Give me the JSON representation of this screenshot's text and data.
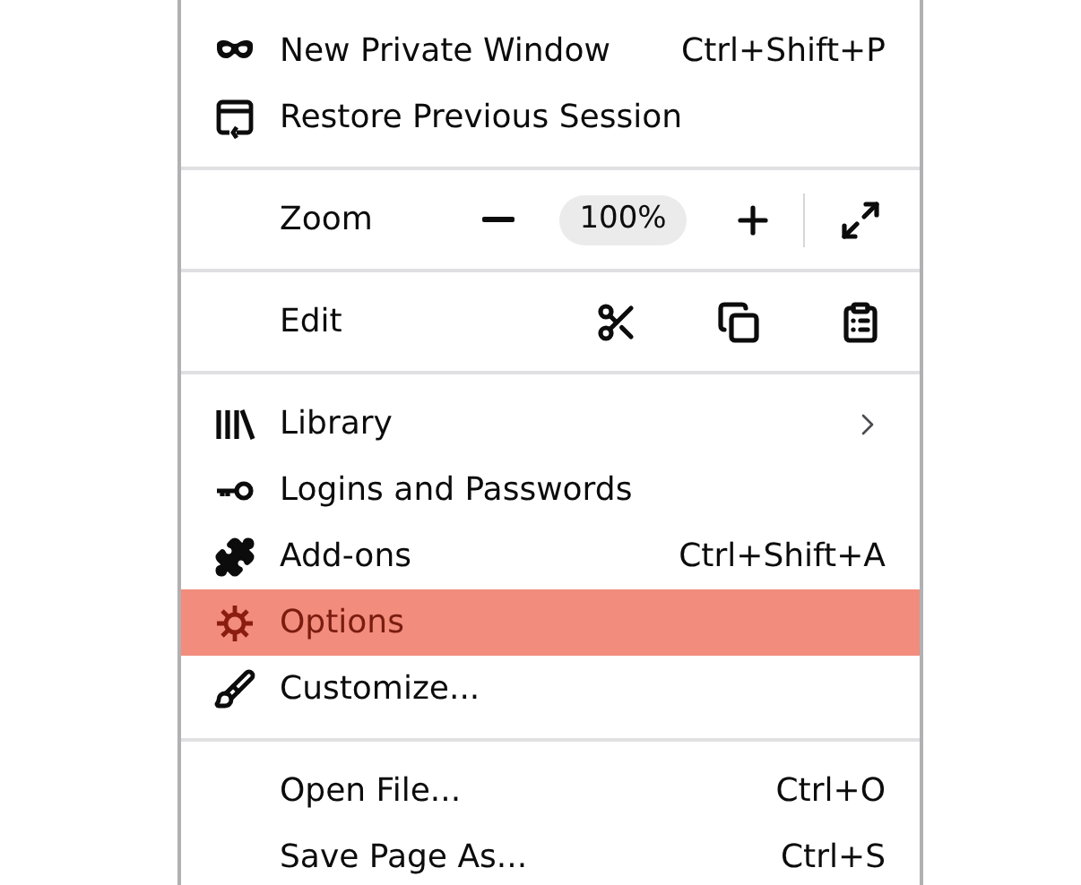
{
  "menu": {
    "sections": [
      {
        "items": [
          {
            "kind": "item",
            "label": "New Private Window",
            "shortcut": "Ctrl+Shift+P",
            "selected": false,
            "submenu": false
          },
          {
            "kind": "item",
            "label": "Restore Previous Session",
            "selected": false,
            "submenu": false
          }
        ]
      },
      {
        "items": [
          {
            "kind": "zoom",
            "label": "Zoom",
            "value": "100%"
          }
        ]
      },
      {
        "items": [
          {
            "kind": "edit",
            "label": "Edit"
          }
        ]
      },
      {
        "items": [
          {
            "kind": "item",
            "label": "Library",
            "selected": false,
            "submenu": true
          },
          {
            "kind": "item",
            "label": "Logins and Passwords",
            "selected": false,
            "submenu": false
          },
          {
            "kind": "item",
            "label": "Add-ons",
            "shortcut": "Ctrl+Shift+A",
            "selected": false,
            "submenu": false
          },
          {
            "kind": "item",
            "label": "Options",
            "selected": true,
            "submenu": false
          },
          {
            "kind": "item",
            "label": "Customize...",
            "selected": false,
            "submenu": false
          }
        ]
      },
      {
        "items": [
          {
            "kind": "item",
            "label": "Open File...",
            "shortcut": "Ctrl+O",
            "selected": false,
            "submenu": false
          },
          {
            "kind": "item",
            "label": "Save Page As...",
            "shortcut": "Ctrl+S",
            "selected": false,
            "submenu": false
          }
        ]
      }
    ]
  }
}
